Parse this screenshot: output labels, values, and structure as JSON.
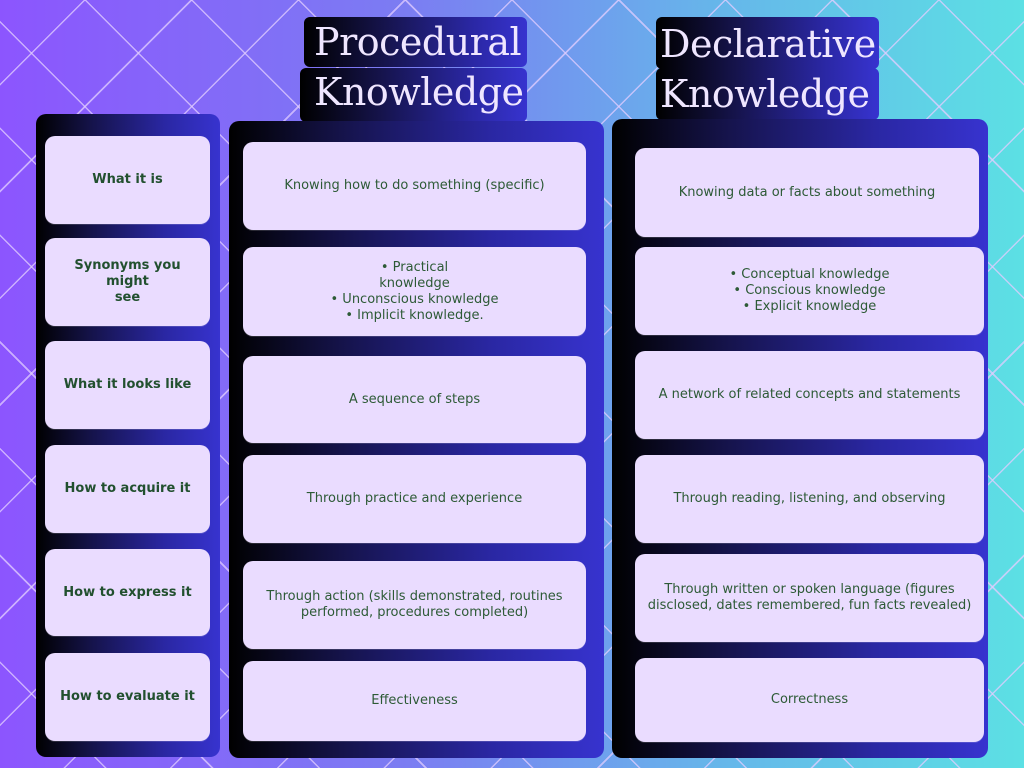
{
  "headers": {
    "procedural": {
      "line1": "Procedural",
      "line2": "Knowledge"
    },
    "declarative": {
      "line1": "Declarative",
      "line2": "Knowledge"
    }
  },
  "rows": [
    {
      "label": "What it is",
      "procedural": "Knowing how to do something (specific)",
      "declarative": "Knowing data or facts about something"
    },
    {
      "label": "Synonyms you might\nsee",
      "procedural": "• Practical\nknowledge\n• Unconscious knowledge\n• Implicit knowledge.",
      "declarative": "• Conceptual knowledge\n• Conscious knowledge\n• Explicit knowledge"
    },
    {
      "label": "What it looks like",
      "procedural": "A sequence of steps",
      "declarative": "A network of related concepts and statements"
    },
    {
      "label": "How to acquire it",
      "procedural": "Through practice and experience",
      "declarative": "Through reading, listening, and observing"
    },
    {
      "label": "How to express it",
      "procedural": "Through action (skills demonstrated, routines\nperformed, procedures completed)",
      "declarative": "Through written or spoken language (figures\ndisclosed, dates remembered, fun facts revealed)"
    },
    {
      "label": "How to evaluate it",
      "procedural": "Effectiveness",
      "declarative": "Correctness"
    }
  ],
  "colors": {
    "card_bg": "#eadcff",
    "label_text": "#22502f",
    "body_text": "#2d5a36",
    "title_text": "#efe6ff",
    "panel_dark": "#000000",
    "panel_light": "#3733cf"
  }
}
